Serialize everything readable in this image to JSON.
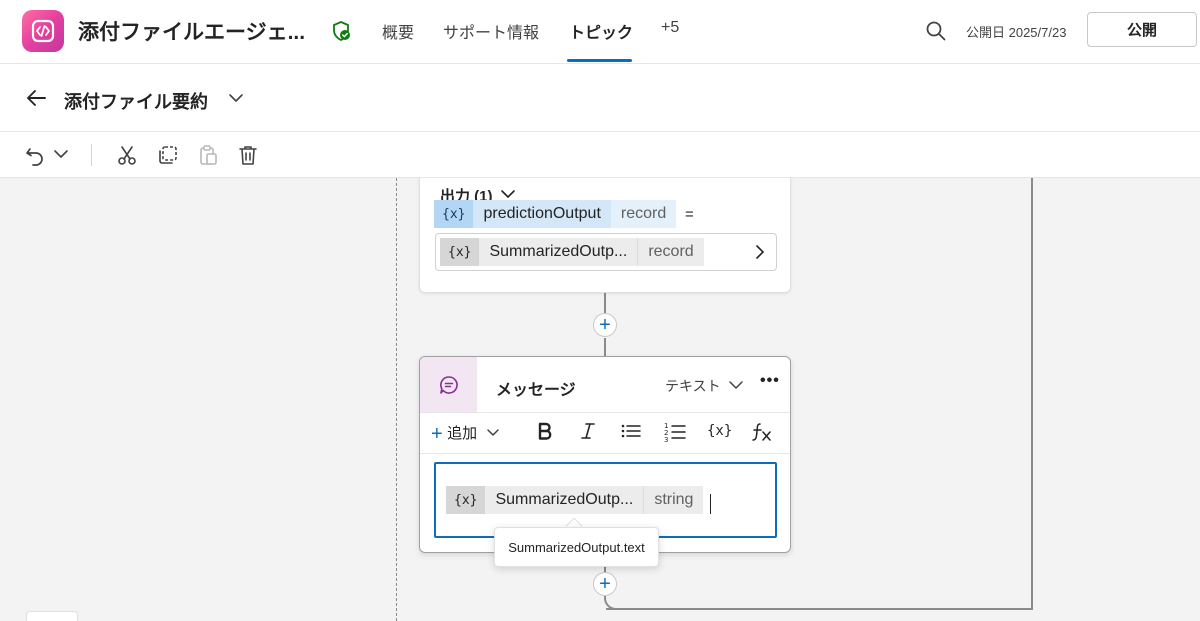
{
  "header": {
    "app_title": "添付ファイルエージェ...",
    "tabs": [
      {
        "label": "概要"
      },
      {
        "label": "サポート情報"
      },
      {
        "label": "トピック"
      },
      {
        "label": "+5"
      }
    ],
    "published_date": "公開日 2025/7/23",
    "publish_label": "公開"
  },
  "topic": {
    "title": "添付ファイル要約"
  },
  "output_node": {
    "label": "出力 (1)",
    "variable": {
      "icon": "{x}",
      "name": "predictionOutput",
      "type": "record"
    },
    "equals": "=",
    "value": {
      "icon": "{x}",
      "name": "SummarizedOutp...",
      "type": "record"
    }
  },
  "message_node": {
    "title": "メッセージ",
    "type_label": "テキスト",
    "add_label": "追加",
    "format_buttons": {
      "var": "{x}"
    },
    "token": {
      "icon": "{x}",
      "name": "SummarizedOutp...",
      "type": "string"
    }
  },
  "tooltip": {
    "text": "SummarizedOutput.text"
  },
  "colors": {
    "accent": "#0f6cbd",
    "app_icon_gradient_start": "#ff6fa3",
    "app_icon_gradient_end": "#c2389f",
    "shield_check": "#107c10",
    "message_icon_bg": "#f1e6f2"
  }
}
